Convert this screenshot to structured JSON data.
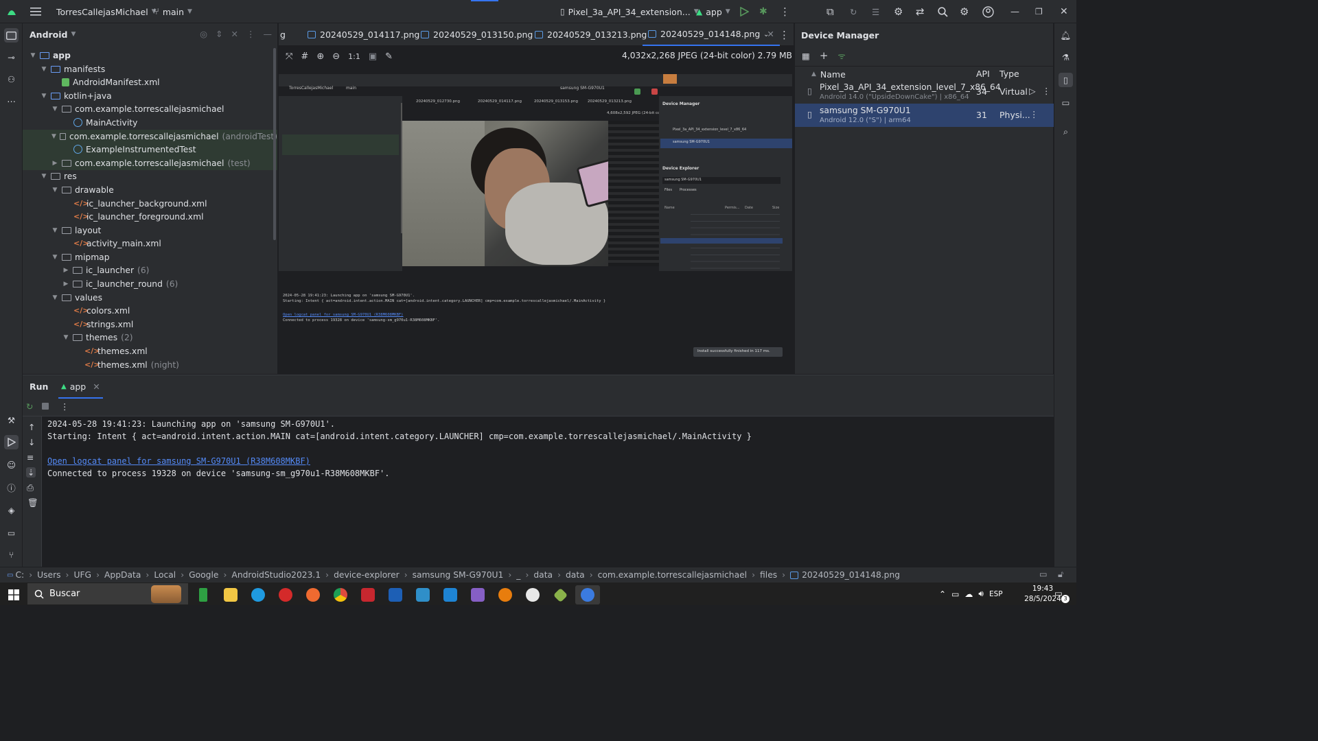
{
  "titlebar": {
    "project": "TorresCallejasMichael",
    "branch": "main",
    "device": "Pixel_3a_API_34_extension...",
    "run_config": "app"
  },
  "project_panel": {
    "view": "Android",
    "tree": [
      {
        "label": "app",
        "suffix": ""
      },
      {
        "label": "manifests",
        "suffix": ""
      },
      {
        "label": "AndroidManifest.xml",
        "suffix": ""
      },
      {
        "label": "kotlin+java",
        "suffix": ""
      },
      {
        "label": "com.example.torrescallejasmichael",
        "suffix": ""
      },
      {
        "label": "MainActivity",
        "suffix": ""
      },
      {
        "label": "com.example.torrescallejasmichael",
        "suffix": "(androidTest)"
      },
      {
        "label": "ExampleInstrumentedTest",
        "suffix": ""
      },
      {
        "label": "com.example.torrescallejasmichael",
        "suffix": "(test)"
      },
      {
        "label": "res",
        "suffix": ""
      },
      {
        "label": "drawable",
        "suffix": ""
      },
      {
        "label": "ic_launcher_background.xml",
        "suffix": ""
      },
      {
        "label": "ic_launcher_foreground.xml",
        "suffix": ""
      },
      {
        "label": "layout",
        "suffix": ""
      },
      {
        "label": "activity_main.xml",
        "suffix": ""
      },
      {
        "label": "mipmap",
        "suffix": ""
      },
      {
        "label": "ic_launcher",
        "suffix": "(6)"
      },
      {
        "label": "ic_launcher_round",
        "suffix": "(6)"
      },
      {
        "label": "values",
        "suffix": ""
      },
      {
        "label": "colors.xml",
        "suffix": ""
      },
      {
        "label": "strings.xml",
        "suffix": ""
      },
      {
        "label": "themes",
        "suffix": "(2)"
      },
      {
        "label": "themes.xml",
        "suffix": ""
      },
      {
        "label": "themes.xml",
        "suffix": "(night)"
      }
    ]
  },
  "editor": {
    "tabs": [
      {
        "label": "g"
      },
      {
        "label": "20240529_014117.png"
      },
      {
        "label": "20240529_013150.png"
      },
      {
        "label": "20240529_013213.png"
      },
      {
        "label": "20240529_014148.png"
      }
    ],
    "image_info": "4,032x2,268 JPEG (24-bit color) 2.79 MB",
    "zoom_label": "1:1"
  },
  "device_manager": {
    "title": "Device Manager",
    "columns": {
      "name": "Name",
      "api": "API",
      "type": "Type"
    },
    "devices": [
      {
        "name": "Pixel_3a_API_34_extension_level_7_x86_64",
        "sub": "Android 14.0 (\"UpsideDownCake\") | x86_64",
        "api": "34",
        "type": "Virtual"
      },
      {
        "name": "samsung SM-G970U1",
        "sub": "Android 12.0 (\"S\") | arm64",
        "api": "31",
        "type": "Physi..."
      }
    ]
  },
  "run": {
    "tab_run": "Run",
    "tab_app": "app",
    "lines": [
      "2024-05-28 19:41:23: Launching app on 'samsung SM-G970U1'.",
      "Starting: Intent { act=android.intent.action.MAIN cat=[android.intent.category.LAUNCHER] cmp=com.example.torrescallejasmichael/.MainActivity }",
      "Open logcat panel for samsung SM-G970U1 (R38M608MKBF)",
      "Connected to process 19328 on device 'samsung-sm_g970u1-R38M608MKBF'."
    ]
  },
  "statusbar": {
    "crumbs": [
      "C:",
      "Users",
      "UFG",
      "AppData",
      "Local",
      "Google",
      "AndroidStudio2023.1",
      "device-explorer",
      "samsung SM-G970U1",
      "_",
      "data",
      "data",
      "com.example.torrescallejasmichael",
      "files",
      "20240529_014148.png"
    ]
  },
  "taskbar": {
    "search": "Buscar",
    "lang": "ESP",
    "time": "19:43",
    "date": "28/5/2024",
    "notif_count": "3"
  },
  "screenshot_inner": {
    "project": "TorresCallejasMichael",
    "branch": "main",
    "device": "samsung SM-G970U1",
    "tabs": [
      "20240529_012730.png",
      "20240529_014117.png",
      "20240529_013153.png",
      "20240529_013213.png"
    ],
    "image_info": "4,608x2,592 JPEG (24-bit color) 3.44 MB",
    "dm_title": "Device Manager",
    "dm_rows": [
      "Pixel_3a_API_34_extension_level_7_x86_64",
      "samsung SM-G970U1"
    ],
    "de_title": "Device Explorer",
    "de_device": "samsung SM-G970U1",
    "de_tabs": [
      "Files",
      "Processes"
    ],
    "de_cols": [
      "Name",
      "Permis...",
      "Date",
      "Size"
    ],
    "console": [
      "2024-05-28 19:41:23: Launching app on 'samsung SM-G970U1'.",
      "Starting: Intent { act=android.intent.action.MAIN cat=[android.intent.category.LAUNCHER] cmp=com.example.torrescallejasmichael/.MainActivity }",
      "Open logcat panel for samsung SM-G970U1 (R38M608MKBF)",
      "Connected to process 19328 on device 'samsung-sm_g970u1-R38M608MKBF'."
    ],
    "toast": "Install successfully finished in 117 ms."
  },
  "colors": {
    "accent": "#3574f0",
    "selection": "#2e436e",
    "test_highlight": "#2f3b33",
    "run_green": "#57965c",
    "link": "#548af7"
  }
}
